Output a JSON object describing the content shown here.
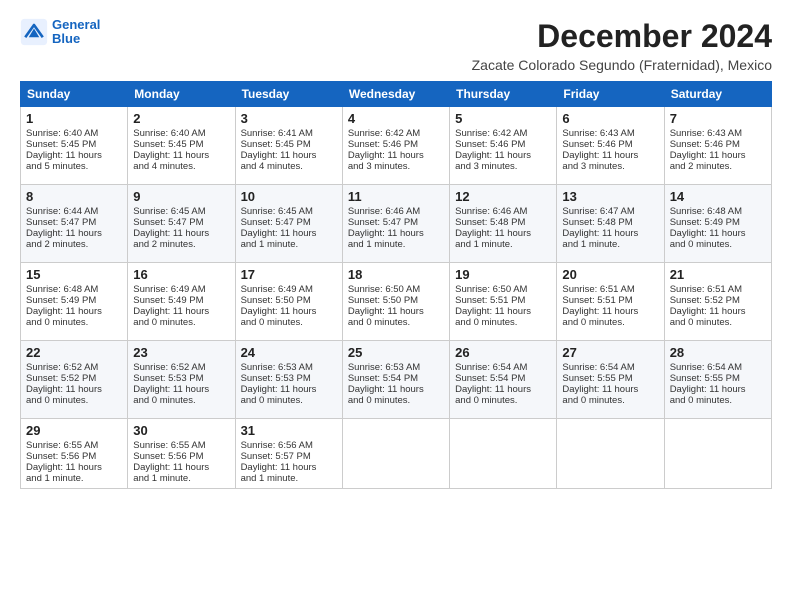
{
  "header": {
    "logo": {
      "line1": "General",
      "line2": "Blue"
    },
    "title": "December 2024",
    "subtitle": "Zacate Colorado Segundo (Fraternidad), Mexico"
  },
  "days_of_week": [
    "Sunday",
    "Monday",
    "Tuesday",
    "Wednesday",
    "Thursday",
    "Friday",
    "Saturday"
  ],
  "weeks": [
    [
      {
        "day": "1",
        "lines": [
          "Sunrise: 6:40 AM",
          "Sunset: 5:45 PM",
          "Daylight: 11 hours",
          "and 5 minutes."
        ]
      },
      {
        "day": "2",
        "lines": [
          "Sunrise: 6:40 AM",
          "Sunset: 5:45 PM",
          "Daylight: 11 hours",
          "and 4 minutes."
        ]
      },
      {
        "day": "3",
        "lines": [
          "Sunrise: 6:41 AM",
          "Sunset: 5:45 PM",
          "Daylight: 11 hours",
          "and 4 minutes."
        ]
      },
      {
        "day": "4",
        "lines": [
          "Sunrise: 6:42 AM",
          "Sunset: 5:46 PM",
          "Daylight: 11 hours",
          "and 3 minutes."
        ]
      },
      {
        "day": "5",
        "lines": [
          "Sunrise: 6:42 AM",
          "Sunset: 5:46 PM",
          "Daylight: 11 hours",
          "and 3 minutes."
        ]
      },
      {
        "day": "6",
        "lines": [
          "Sunrise: 6:43 AM",
          "Sunset: 5:46 PM",
          "Daylight: 11 hours",
          "and 3 minutes."
        ]
      },
      {
        "day": "7",
        "lines": [
          "Sunrise: 6:43 AM",
          "Sunset: 5:46 PM",
          "Daylight: 11 hours",
          "and 2 minutes."
        ]
      }
    ],
    [
      {
        "day": "8",
        "lines": [
          "Sunrise: 6:44 AM",
          "Sunset: 5:47 PM",
          "Daylight: 11 hours",
          "and 2 minutes."
        ]
      },
      {
        "day": "9",
        "lines": [
          "Sunrise: 6:45 AM",
          "Sunset: 5:47 PM",
          "Daylight: 11 hours",
          "and 2 minutes."
        ]
      },
      {
        "day": "10",
        "lines": [
          "Sunrise: 6:45 AM",
          "Sunset: 5:47 PM",
          "Daylight: 11 hours",
          "and 1 minute."
        ]
      },
      {
        "day": "11",
        "lines": [
          "Sunrise: 6:46 AM",
          "Sunset: 5:47 PM",
          "Daylight: 11 hours",
          "and 1 minute."
        ]
      },
      {
        "day": "12",
        "lines": [
          "Sunrise: 6:46 AM",
          "Sunset: 5:48 PM",
          "Daylight: 11 hours",
          "and 1 minute."
        ]
      },
      {
        "day": "13",
        "lines": [
          "Sunrise: 6:47 AM",
          "Sunset: 5:48 PM",
          "Daylight: 11 hours",
          "and 1 minute."
        ]
      },
      {
        "day": "14",
        "lines": [
          "Sunrise: 6:48 AM",
          "Sunset: 5:49 PM",
          "Daylight: 11 hours",
          "and 0 minutes."
        ]
      }
    ],
    [
      {
        "day": "15",
        "lines": [
          "Sunrise: 6:48 AM",
          "Sunset: 5:49 PM",
          "Daylight: 11 hours",
          "and 0 minutes."
        ]
      },
      {
        "day": "16",
        "lines": [
          "Sunrise: 6:49 AM",
          "Sunset: 5:49 PM",
          "Daylight: 11 hours",
          "and 0 minutes."
        ]
      },
      {
        "day": "17",
        "lines": [
          "Sunrise: 6:49 AM",
          "Sunset: 5:50 PM",
          "Daylight: 11 hours",
          "and 0 minutes."
        ]
      },
      {
        "day": "18",
        "lines": [
          "Sunrise: 6:50 AM",
          "Sunset: 5:50 PM",
          "Daylight: 11 hours",
          "and 0 minutes."
        ]
      },
      {
        "day": "19",
        "lines": [
          "Sunrise: 6:50 AM",
          "Sunset: 5:51 PM",
          "Daylight: 11 hours",
          "and 0 minutes."
        ]
      },
      {
        "day": "20",
        "lines": [
          "Sunrise: 6:51 AM",
          "Sunset: 5:51 PM",
          "Daylight: 11 hours",
          "and 0 minutes."
        ]
      },
      {
        "day": "21",
        "lines": [
          "Sunrise: 6:51 AM",
          "Sunset: 5:52 PM",
          "Daylight: 11 hours",
          "and 0 minutes."
        ]
      }
    ],
    [
      {
        "day": "22",
        "lines": [
          "Sunrise: 6:52 AM",
          "Sunset: 5:52 PM",
          "Daylight: 11 hours",
          "and 0 minutes."
        ]
      },
      {
        "day": "23",
        "lines": [
          "Sunrise: 6:52 AM",
          "Sunset: 5:53 PM",
          "Daylight: 11 hours",
          "and 0 minutes."
        ]
      },
      {
        "day": "24",
        "lines": [
          "Sunrise: 6:53 AM",
          "Sunset: 5:53 PM",
          "Daylight: 11 hours",
          "and 0 minutes."
        ]
      },
      {
        "day": "25",
        "lines": [
          "Sunrise: 6:53 AM",
          "Sunset: 5:54 PM",
          "Daylight: 11 hours",
          "and 0 minutes."
        ]
      },
      {
        "day": "26",
        "lines": [
          "Sunrise: 6:54 AM",
          "Sunset: 5:54 PM",
          "Daylight: 11 hours",
          "and 0 minutes."
        ]
      },
      {
        "day": "27",
        "lines": [
          "Sunrise: 6:54 AM",
          "Sunset: 5:55 PM",
          "Daylight: 11 hours",
          "and 0 minutes."
        ]
      },
      {
        "day": "28",
        "lines": [
          "Sunrise: 6:54 AM",
          "Sunset: 5:55 PM",
          "Daylight: 11 hours",
          "and 0 minutes."
        ]
      }
    ],
    [
      {
        "day": "29",
        "lines": [
          "Sunrise: 6:55 AM",
          "Sunset: 5:56 PM",
          "Daylight: 11 hours",
          "and 1 minute."
        ]
      },
      {
        "day": "30",
        "lines": [
          "Sunrise: 6:55 AM",
          "Sunset: 5:56 PM",
          "Daylight: 11 hours",
          "and 1 minute."
        ]
      },
      {
        "day": "31",
        "lines": [
          "Sunrise: 6:56 AM",
          "Sunset: 5:57 PM",
          "Daylight: 11 hours",
          "and 1 minute."
        ]
      },
      null,
      null,
      null,
      null
    ]
  ]
}
